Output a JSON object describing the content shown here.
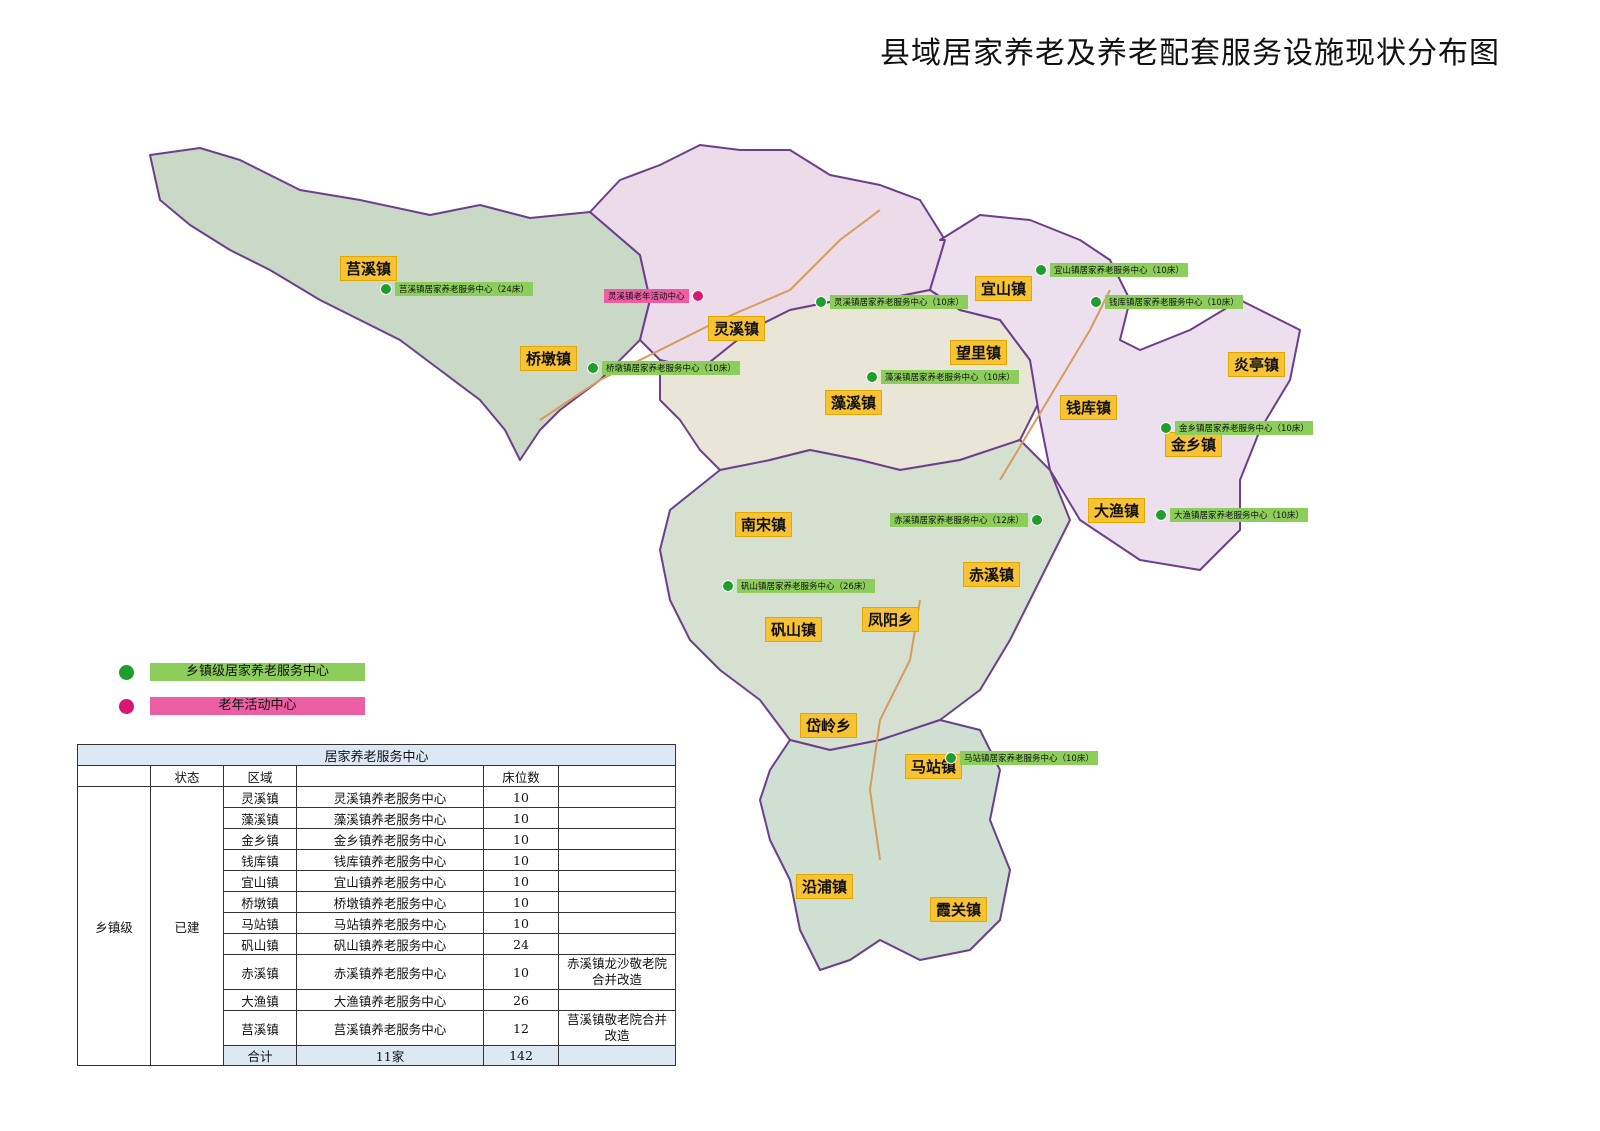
{
  "title": "县域居家养老及养老配套服务设施现状分布图",
  "colors": {
    "green_dot": "#1f9e2e",
    "green_label": "#8ccd5c",
    "pink_dot": "#d6186e",
    "pink_label": "#ec5ea3",
    "town_label": "#f7c233",
    "table_header": "#dce9f5"
  },
  "towns": [
    "莒溪镇",
    "灵溪镇",
    "桥墩镇",
    "宜山镇",
    "望里镇",
    "藻溪镇",
    "钱库镇",
    "炎亭镇",
    "金乡镇",
    "大渔镇",
    "南宋镇",
    "赤溪镇",
    "凤阳乡",
    "矾山镇",
    "岱岭乡",
    "马站镇",
    "沿浦镇",
    "霞关镇"
  ],
  "facilities": [
    {
      "type": "green",
      "label": "莒溪镇居家养老服务中心（24床）"
    },
    {
      "type": "pink",
      "label": "灵溪镇老年活动中心"
    },
    {
      "type": "green",
      "label": "灵溪镇居家养老服务中心（10床）"
    },
    {
      "type": "green",
      "label": "桥墩镇居家养老服务中心（10床）"
    },
    {
      "type": "green",
      "label": "宜山镇居家养老服务中心（10床）"
    },
    {
      "type": "green",
      "label": "钱库镇居家养老服务中心（10床）"
    },
    {
      "type": "green",
      "label": "藻溪镇居家养老服务中心（10床）"
    },
    {
      "type": "green",
      "label": "金乡镇居家养老服务中心（10床）"
    },
    {
      "type": "green",
      "label": "赤溪镇居家养老服务中心（12床）"
    },
    {
      "type": "green",
      "label": "大渔镇居家养老服务中心（10床）"
    },
    {
      "type": "green",
      "label": "矾山镇居家养老服务中心（26床）"
    },
    {
      "type": "green",
      "label": "马站镇居家养老服务中心（10床）"
    }
  ],
  "legend": [
    {
      "type": "green",
      "label": "乡镇级居家养老服务中心"
    },
    {
      "type": "pink",
      "label": "老年活动中心"
    }
  ],
  "table": {
    "title": "居家养老服务中心",
    "columns": [
      "",
      "状态",
      "区域",
      "",
      "床位数",
      ""
    ],
    "level": "乡镇级",
    "status": "已建",
    "rows": [
      {
        "area": "灵溪镇",
        "name": "灵溪镇养老服务中心",
        "beds": "10",
        "note": ""
      },
      {
        "area": "藻溪镇",
        "name": "藻溪镇养老服务中心",
        "beds": "10",
        "note": ""
      },
      {
        "area": "金乡镇",
        "name": "金乡镇养老服务中心",
        "beds": "10",
        "note": ""
      },
      {
        "area": "钱库镇",
        "name": "钱库镇养老服务中心",
        "beds": "10",
        "note": ""
      },
      {
        "area": "宜山镇",
        "name": "宜山镇养老服务中心",
        "beds": "10",
        "note": ""
      },
      {
        "area": "桥墩镇",
        "name": "桥墩镇养老服务中心",
        "beds": "10",
        "note": ""
      },
      {
        "area": "马站镇",
        "name": "马站镇养老服务中心",
        "beds": "10",
        "note": ""
      },
      {
        "area": "矾山镇",
        "name": "矾山镇养老服务中心",
        "beds": "24",
        "note": ""
      },
      {
        "area": "赤溪镇",
        "name": "赤溪镇养老服务中心",
        "beds": "10",
        "note": "赤溪镇龙沙敬老院合并改造"
      },
      {
        "area": "大渔镇",
        "name": "大渔镇养老服务中心",
        "beds": "26",
        "note": ""
      },
      {
        "area": "莒溪镇",
        "name": "莒溪镇养老服务中心",
        "beds": "12",
        "note": "莒溪镇敬老院合并改造"
      }
    ],
    "total": {
      "label": "合计",
      "count": "11家",
      "beds": "142"
    }
  }
}
